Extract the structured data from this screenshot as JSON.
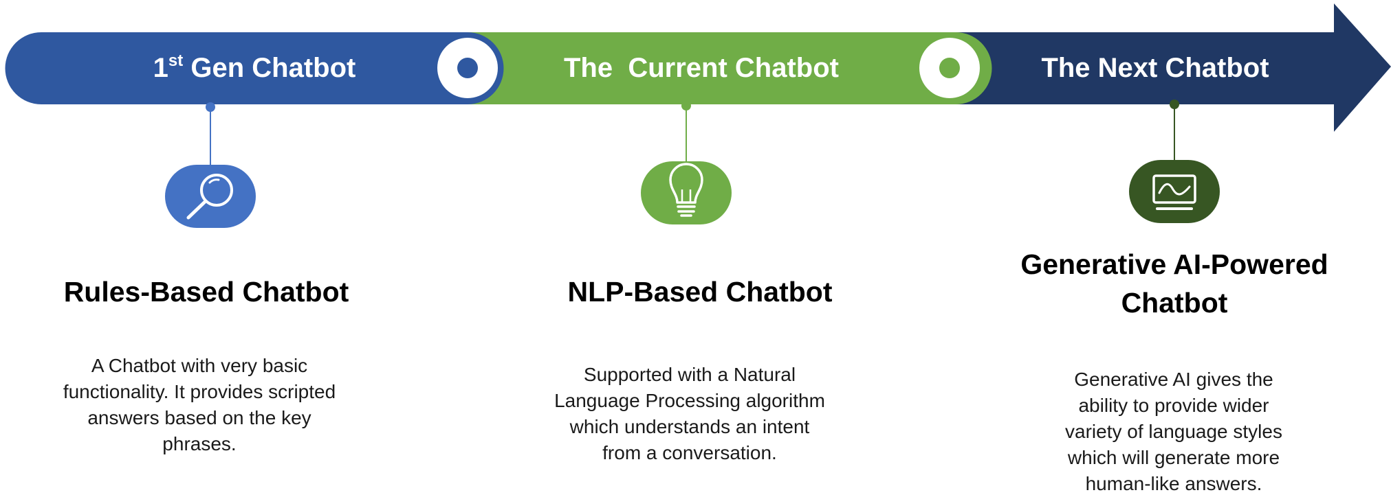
{
  "colors": {
    "blue": "#2f58a0",
    "green": "#70ad47",
    "navy": "#203864",
    "icon_blue": "#4472c4",
    "icon_green": "#70ad47",
    "icon_darkgreen": "#375623"
  },
  "stages": [
    {
      "label_main": "1",
      "label_sup": "st",
      "label_rest": " Gen Chatbot",
      "icon": "magnifier-icon",
      "heading": "Rules-Based Chatbot",
      "description": "A Chatbot with very basic functionality. It provides scripted answers based on the key phrases."
    },
    {
      "label_main": "The  Current Chatbot",
      "icon": "lightbulb-icon",
      "heading": "NLP-Based Chatbot",
      "description": "Supported with a Natural Language Processing algorithm which understands an intent from a conversation."
    },
    {
      "label_main": "The Next Chatbot",
      "icon": "monitor-waveform-icon",
      "heading": "Generative AI-Powered Chatbot",
      "description": "Generative AI gives the ability to provide wider variety of language styles which will generate more human-like answers."
    }
  ]
}
